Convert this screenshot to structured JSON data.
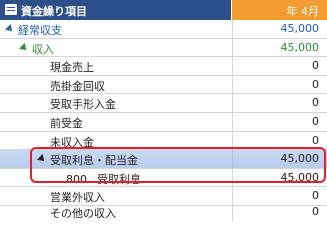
{
  "header": {
    "title": "資金繰り項目",
    "month": "年  4月"
  },
  "rows": [
    {
      "label": "経常収支",
      "value": "45,000"
    },
    {
      "label": "収入",
      "value": "45,000"
    },
    {
      "label": "現金売上",
      "value": "0"
    },
    {
      "label": "売掛金回収",
      "value": "0"
    },
    {
      "label": "受取手形入金",
      "value": "0"
    },
    {
      "label": "前受金",
      "value": "0"
    },
    {
      "label": "未収入金",
      "value": "0"
    },
    {
      "label": "受取利息・配当金",
      "value": "45,000"
    },
    {
      "code": "800",
      "label": "受取利息",
      "value": "45,000"
    },
    {
      "label": "営業外収入",
      "value": "0"
    },
    {
      "label": "その他の収入",
      "value": "0"
    }
  ],
  "colors": {
    "header_bg": "#2c4f8a",
    "month_bg": "#f39c32",
    "accent_blue": "#1f5ea8",
    "accent_green": "#2e8b37",
    "selection_border": "#e0202e"
  }
}
